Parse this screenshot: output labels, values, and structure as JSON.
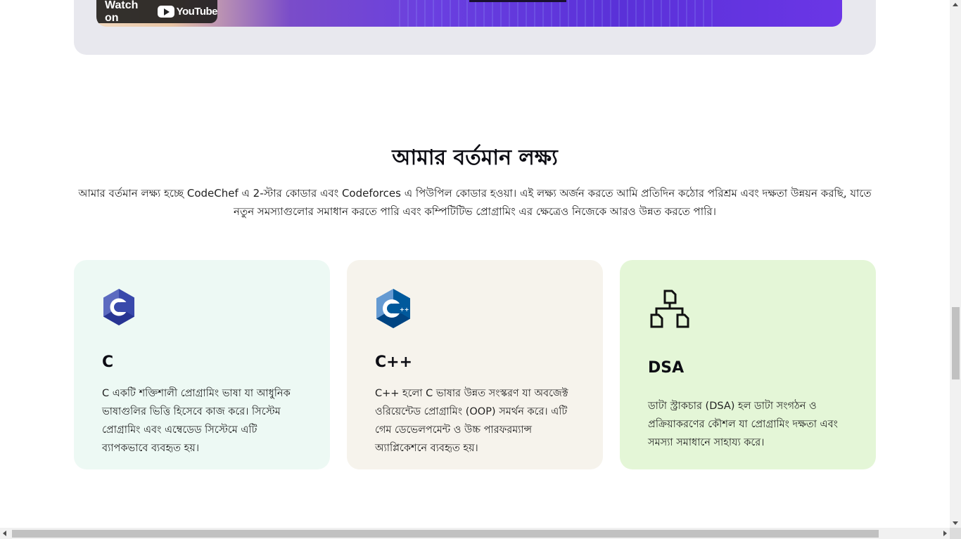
{
  "video": {
    "watch_label": "Watch on",
    "platform_label": "YouTube"
  },
  "goal_section": {
    "title": "আমার বর্তমান লক্ষ্য",
    "description": "আমার বর্তমান লক্ষ্য হচ্ছে CodeChef এ 2-স্টার কোডার এবং Codeforces এ পিউপিল কোডার হওয়া। এই লক্ষ্য অর্জন করতে আমি প্রতিদিন কঠোর পরিশ্রম এবং দক্ষতা উন্নয়ন করছি, যাতে নতুন সমস্যাগুলোর সমাধান করতে পারি এবং কম্পিটিটিভ প্রোগ্রামিং এর ক্ষেত্রেও নিজেকে আরও উন্নত করতে পারি।"
  },
  "cards": [
    {
      "title": "C",
      "icon": "c-language-icon",
      "text": "C একটি শক্তিশালী প্রোগ্রামিং ভাষা যা আধুনিক ভাষাগুলির ভিত্তি হিসেবে কাজ করে। সিস্টেম প্রোগ্রামিং এবং এম্বেডেড সিস্টেমে এটি ব্যাপকভাবে ব্যবহৃত হয়।",
      "bg": "#edf9f4"
    },
    {
      "title": "C++",
      "icon": "cpp-language-icon",
      "text": "C++ হলো C ভাষার উন্নত সংস্করণ যা অবজেক্ট ওরিয়েন্টেড প্রোগ্রামিং (OOP) সমর্থন করে। এটি গেম ডেভেলপমেন্ট ও উচ্চ পারফরম্যান্স অ্যাপ্লিকেশনে ব্যবহৃত হয়।",
      "bg": "#f6f3ec"
    },
    {
      "title": "DSA",
      "icon": "data-structure-tree-icon",
      "text": "ডাটা স্ট্রাকচার (DSA) হল ডাটা সংগঠন ও প্রক্রিয়াকরণের কৌশল যা প্রোগ্রামিং দক্ষতা এবং সমস্যা সমাধানে সাহায্য করে।",
      "bg": "#e4f6d7"
    }
  ]
}
